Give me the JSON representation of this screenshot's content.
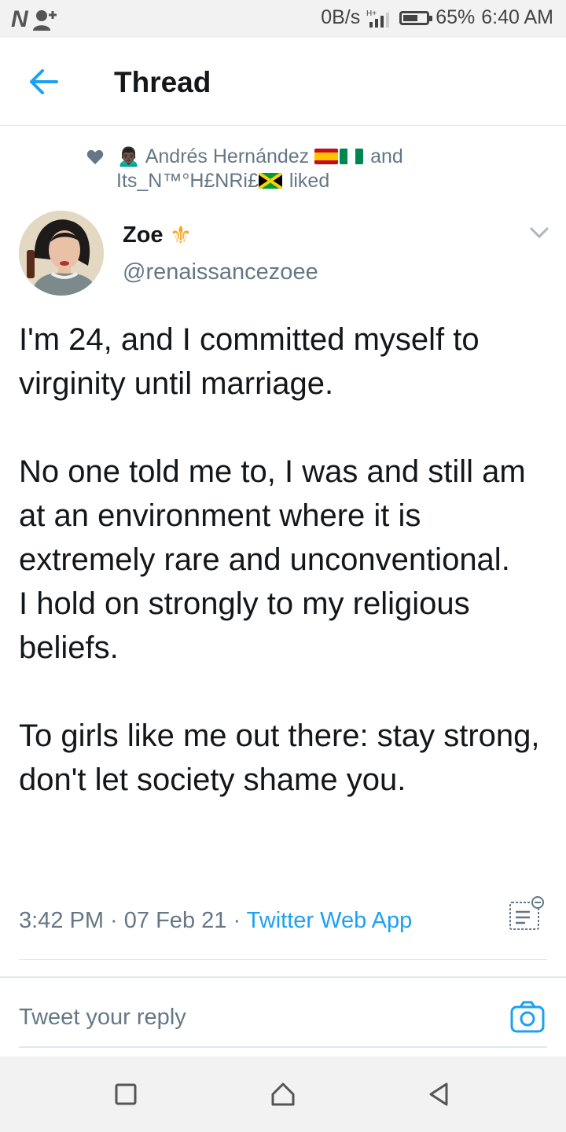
{
  "status_bar": {
    "network_speed": "0B/s",
    "battery": "65%",
    "battery_level": 0.65,
    "time": "6:40 AM",
    "left_icons": [
      "n-icon",
      "add-user-icon"
    ],
    "right_icons": [
      "signal-icon",
      "battery-icon"
    ]
  },
  "header": {
    "back_icon": "arrow-left-icon",
    "title": "Thread"
  },
  "social_context": {
    "icon": "heart-icon",
    "person_emoji": "🙍🏿‍♂️",
    "user1": "Andrés Hernández",
    "user1_flags": [
      "spain-flag",
      "nigeria-flag"
    ],
    "and": "and",
    "user2": "Its_N™°H£NRi£",
    "user2_flags": [
      "jamaica-flag"
    ],
    "action": "liked"
  },
  "tweet": {
    "author_name": "Zoe",
    "author_badge": "⚜",
    "author_handle": "@renaissancezoee",
    "paragraphs": [
      "I'm 24, and I committed myself to virginity until marriage.",
      "No one told me to, I was and still am at an environment where it is extremely rare and unconventional.",
      "I hold on strongly to my religious beliefs.",
      "To girls like me out there: stay strong, don't let society shame you."
    ],
    "time": "3:42 PM",
    "sep1": " · ",
    "date": "07 Feb 21",
    "sep2": " · ",
    "source": "Twitter Web App"
  },
  "reply": {
    "placeholder": "Tweet your reply",
    "camera_icon": "camera-icon"
  },
  "colors": {
    "accent": "#1da1f2",
    "secondary_text": "#657786",
    "primary_text": "#14171a",
    "divider": "#e1e8ed",
    "badge": "#f5a623"
  },
  "nav_bar": [
    "recents-square-icon",
    "home-circle-icon",
    "back-triangle-icon"
  ]
}
